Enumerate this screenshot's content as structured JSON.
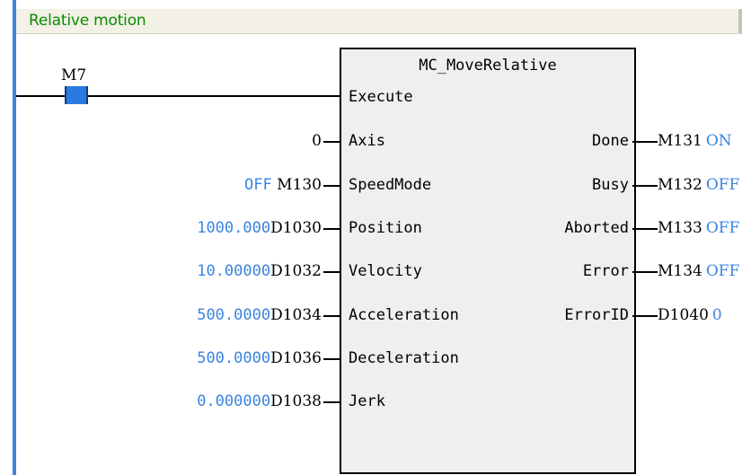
{
  "rung": {
    "title": "Relative motion"
  },
  "contact": {
    "label": "M7"
  },
  "function_block": {
    "name": "MC_MoveRelative",
    "inputs": [
      {
        "pin": "Execute"
      },
      {
        "pin": "Axis",
        "const": "0"
      },
      {
        "pin": "SpeedMode",
        "value": "OFF",
        "address": "M130"
      },
      {
        "pin": "Position",
        "value": "1000.000",
        "address": "D1030"
      },
      {
        "pin": "Velocity",
        "value": "10.00000",
        "address": "D1032"
      },
      {
        "pin": "Acceleration",
        "value": "500.0000",
        "address": "D1034"
      },
      {
        "pin": "Deceleration",
        "value": "500.0000",
        "address": "D1036"
      },
      {
        "pin": "Jerk",
        "value": "0.000000",
        "address": "D1038"
      }
    ],
    "outputs": [
      {
        "pin": "Done",
        "address": "M131",
        "value": "ON"
      },
      {
        "pin": "Busy",
        "address": "M132",
        "value": "OFF"
      },
      {
        "pin": "Aborted",
        "address": "M133",
        "value": "OFF"
      },
      {
        "pin": "Error",
        "address": "M134",
        "value": "OFF"
      },
      {
        "pin": "ErrorID",
        "address": "D1040",
        "value": "0"
      }
    ]
  },
  "colors": {
    "value": "#3a84e0",
    "contact": "#2a7be0",
    "title": "#0a8a00"
  }
}
